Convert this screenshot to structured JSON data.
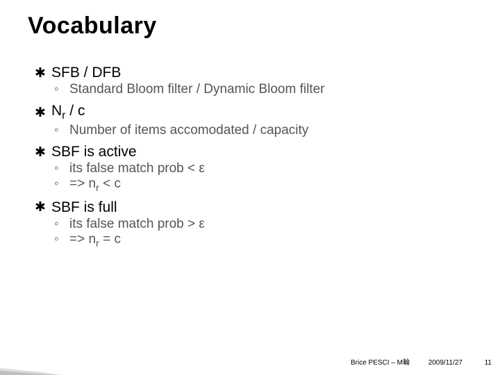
{
  "title": "Vocabulary",
  "items": [
    {
      "head": "SFB / DFB",
      "subs": [
        "Standard Bloom filter / Dynamic Bloom filter"
      ]
    },
    {
      "head_html": "N<span class='sub-r'>r</span> / c",
      "subs": [
        "Number of items accomodated / capacity"
      ]
    },
    {
      "head": "SBF is active",
      "subs_html": [
        "its false match prob &lt; ε",
        "=&gt; n<span class='sub-r'>r</span> &lt; c"
      ]
    },
    {
      "head": "SBF is full",
      "subs_html": [
        "its false match prob &gt; ε",
        "=&gt; n<span class='sub-r'>r</span> = c"
      ]
    }
  ],
  "footer": {
    "author": "Brice PESCI – M輪",
    "date": "2009/11/27",
    "page": "11"
  },
  "glyphs": {
    "main_bullet": "✱",
    "sub_bullet": "◦"
  }
}
